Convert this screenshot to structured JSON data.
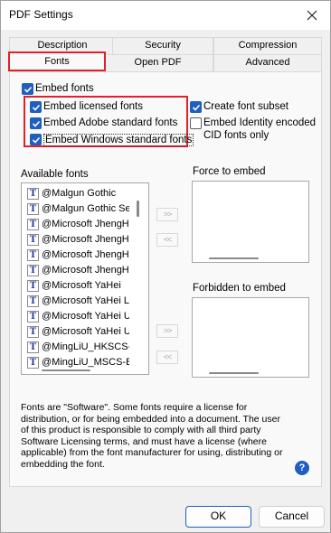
{
  "window": {
    "title": "PDF Settings"
  },
  "tabs": [
    {
      "label": "Description",
      "selected": false
    },
    {
      "label": "Security",
      "selected": false
    },
    {
      "label": "Compression",
      "selected": false
    },
    {
      "label": "Fonts",
      "selected": true
    },
    {
      "label": "Open PDF",
      "selected": false
    },
    {
      "label": "Advanced",
      "selected": false
    }
  ],
  "fonts_tab": {
    "embed_fonts": {
      "label": "Embed fonts",
      "checked": true
    },
    "embed_licensed": {
      "label": "Embed licensed fonts",
      "checked": true
    },
    "embed_adobe": {
      "label": "Embed Adobe standard fonts",
      "checked": true
    },
    "embed_windows": {
      "label": "Embed Windows standard fonts",
      "checked": true
    },
    "create_subset": {
      "label": "Create font subset",
      "checked": true
    },
    "embed_identity": {
      "label_line1": "Embed Identity encoded",
      "label_line2": "CID fonts only",
      "checked": false
    },
    "available_fonts_label": "Available fonts",
    "force_embed_label": "Force to embed",
    "forbidden_embed_label": "Forbidden to embed",
    "available_fonts": [
      "@Malgun Gothic",
      "@Malgun Gothic Semilight",
      "@Microsoft JhengHei",
      "@Microsoft JhengHei Light",
      "@Microsoft JhengHei UI",
      "@Microsoft JhengHei UI Light",
      "@Microsoft YaHei",
      "@Microsoft YaHei Light",
      "@Microsoft YaHei UI",
      "@Microsoft YaHei UI Light",
      "@MingLiU_HKSCS-ExtB",
      "@MingLiU_MSCS-ExtB"
    ],
    "add_arrow": ">>",
    "remove_arrow": "<<",
    "note": "Fonts are \"Software\". Some fonts require a license for distribution, or for being embedded into a document. The user of this product is responsible to comply with all third party Software Licensing terms, and must have a license (where applicable) from the font manufacturer for using, distributing or embedding the font.",
    "help_icon_glyph": "?"
  },
  "buttons": {
    "ok": "OK",
    "cancel": "Cancel"
  },
  "colors": {
    "accent": "#1f5fbf",
    "highlight_box": "#e0202a"
  }
}
